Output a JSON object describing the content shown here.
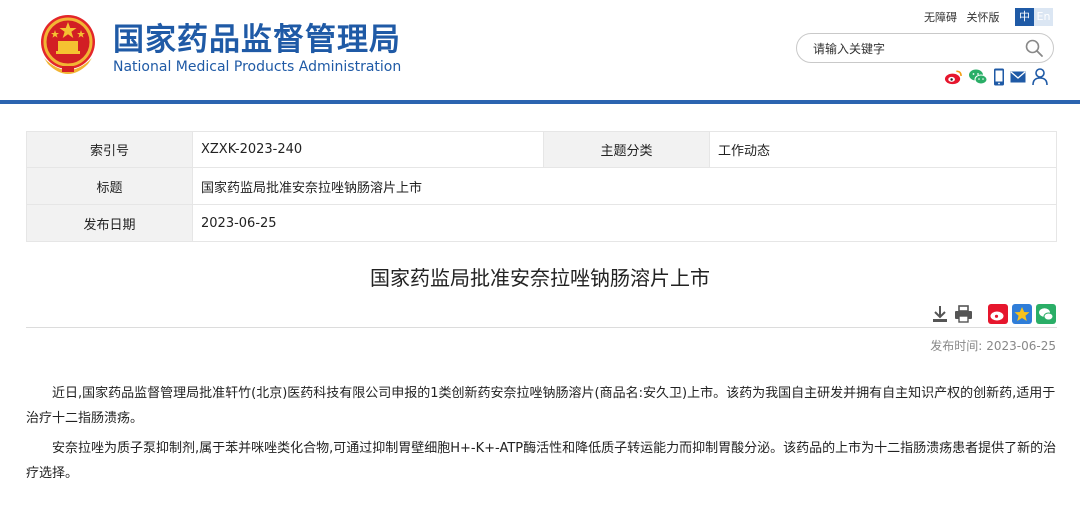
{
  "header": {
    "site_name_cn": "国家药品监督管理局",
    "site_name_en": "National Medical Products Administration",
    "links": {
      "accessibility": "无障碍",
      "care_mode": "关怀版"
    },
    "lang": {
      "zh": "中",
      "en": "En"
    },
    "search": {
      "placeholder": "请输入关键字"
    },
    "social_icons": [
      "weibo-icon",
      "wechat-icon",
      "mobile-icon",
      "mail-icon",
      "user-icon"
    ],
    "brand_color": "#1f5aa6"
  },
  "meta": {
    "index_label": "索引号",
    "index_value": "XZXK-2023-240",
    "category_label": "主题分类",
    "category_value": "工作动态",
    "title_label": "标题",
    "title_value": "国家药监局批准安奈拉唑钠肠溶片上市",
    "date_label": "发布日期",
    "date_value": "2023-06-25"
  },
  "article": {
    "title": "国家药监局批准安奈拉唑钠肠溶片上市",
    "pub_label": "发布时间:",
    "pub_date": "2023-06-25",
    "paragraphs": [
      "近日,国家药品监督管理局批准轩竹(北京)医药科技有限公司申报的1类创新药安奈拉唑钠肠溶片(商品名:安久卫)上市。该药为我国自主研发并拥有自主知识产权的创新药,适用于治疗十二指肠溃疡。",
      "安奈拉唑为质子泵抑制剂,属于苯并咪唑类化合物,可通过抑制胃壁细胞H+-K+-ATP酶活性和降低质子转运能力而抑制胃酸分泌。该药品的上市为十二指肠溃疡患者提供了新的治疗选择。"
    ]
  }
}
